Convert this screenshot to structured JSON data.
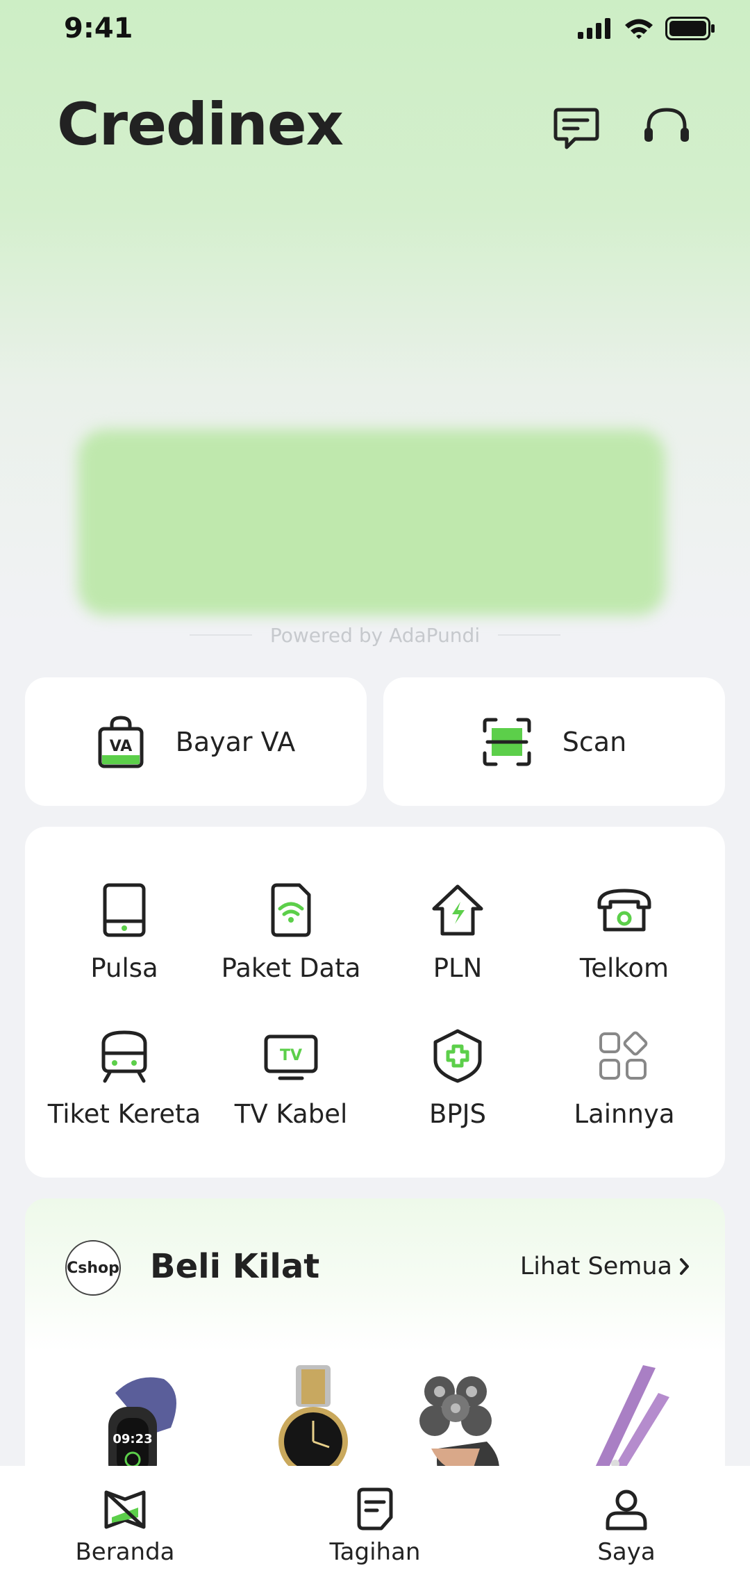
{
  "status": {
    "time": "9:41"
  },
  "app": {
    "title": "Credinex"
  },
  "header_icons": [
    "message-icon",
    "headset-icon"
  ],
  "banner": {
    "powered_by": "Powered by AdaPundi"
  },
  "quick_actions": [
    {
      "label": "Bayar VA",
      "icon": "va-bag-icon"
    },
    {
      "label": "Scan",
      "icon": "scan-icon"
    }
  ],
  "services": [
    {
      "label": "Pulsa",
      "icon": "phone-icon"
    },
    {
      "label": "Paket Data",
      "icon": "sim-data-icon"
    },
    {
      "label": "PLN",
      "icon": "electricity-house-icon"
    },
    {
      "label": "Telkom",
      "icon": "telephone-icon"
    },
    {
      "label": "Tiket Kereta",
      "icon": "train-icon"
    },
    {
      "label": "TV Kabel",
      "icon": "tv-icon"
    },
    {
      "label": "BPJS",
      "icon": "health-shield-icon"
    },
    {
      "label": "Lainnya",
      "icon": "more-apps-icon"
    }
  ],
  "flash_sale": {
    "shop_logo": "Cshop",
    "title": "Beli Kilat",
    "see_all": "Lihat Semua",
    "products": [
      "smart-band",
      "wrist-watch",
      "electric-shaver",
      "hair-straightener"
    ]
  },
  "bottom_nav": [
    {
      "label": "Beranda",
      "icon": "home-icon",
      "active": true
    },
    {
      "label": "Tagihan",
      "icon": "bill-icon",
      "active": false
    },
    {
      "label": "Saya",
      "icon": "profile-icon",
      "active": false
    }
  ],
  "colors": {
    "accent": "#5ccf4a",
    "text": "#222222",
    "bg_top": "#cdeec5"
  }
}
